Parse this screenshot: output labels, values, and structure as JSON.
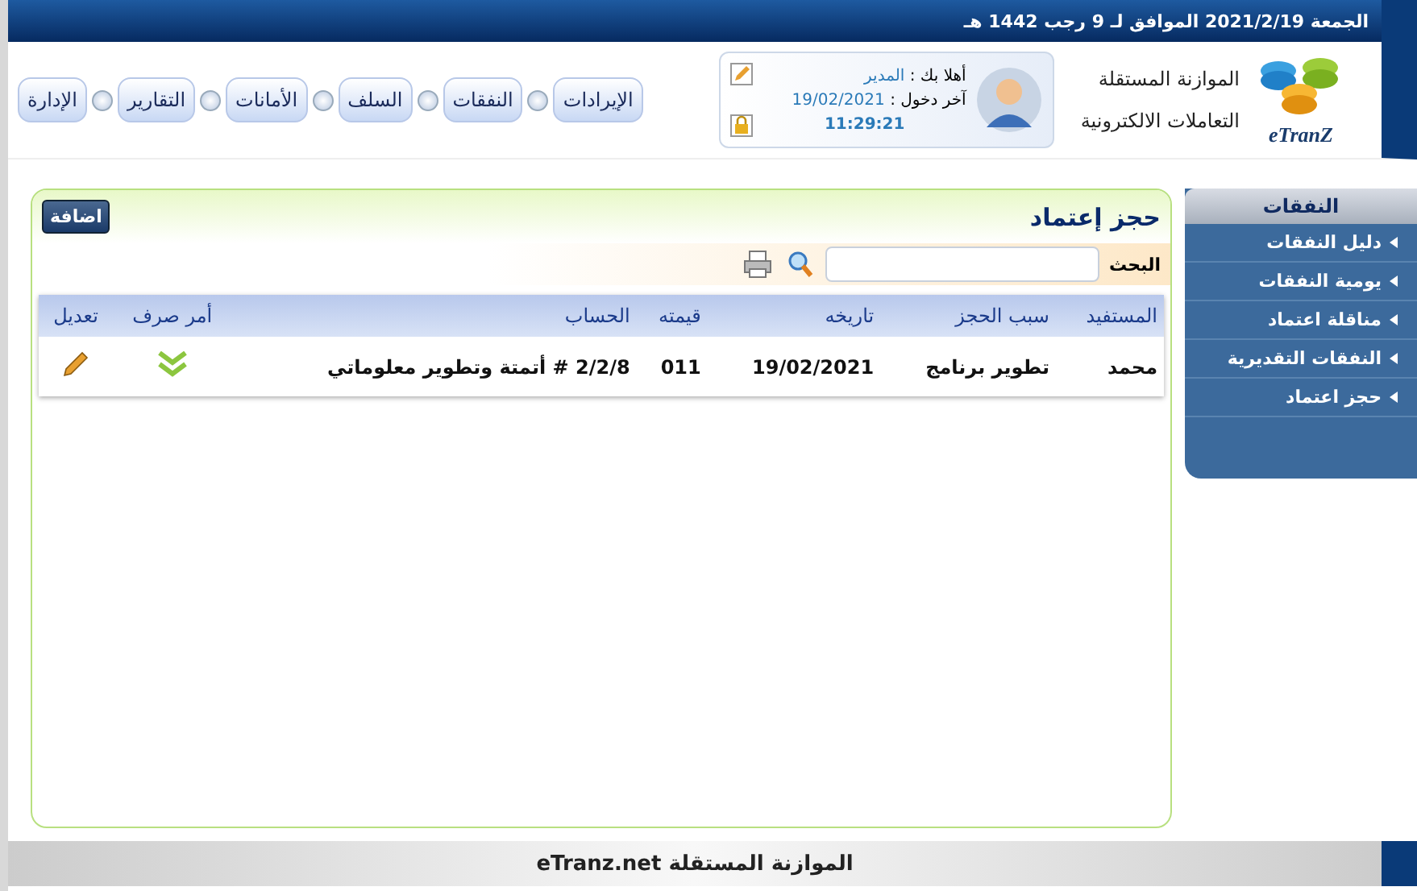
{
  "top_bar": {
    "date": "الجمعة 2021/2/19 الموافق لـ 9 رجب 1442 هـ"
  },
  "logo": {
    "name": "eTranZ",
    "title_line_1": "الموازنة المستقلة",
    "title_line_2": "التعاملات الالكترونية"
  },
  "user_panel": {
    "greeting": "أهلا بك :",
    "user": "المدير",
    "last_login_label": "آخر دخول :",
    "last_login_date": "19/02/2021",
    "last_login_time": "11:29:21"
  },
  "nav": [
    "الإيرادات",
    "النفقات",
    "السلف",
    "الأمانات",
    "التقارير",
    "الإدارة"
  ],
  "sidebar": {
    "title": "النفقات",
    "items": [
      "دليل النفقات",
      "يومية النفقات",
      "مناقلة اعتماد",
      "النفقات التقديرية",
      "حجز اعتماد"
    ]
  },
  "panel": {
    "title": "حجز إعتماد",
    "add_button": "اضافة",
    "search_label": "البحث",
    "table": {
      "columns": [
        "المستفيد",
        "سبب الحجز",
        "تاريخه",
        "قيمته",
        "الحساب",
        "أمر صرف",
        "تعديل"
      ],
      "rows": [
        {
          "cells": [
            "محمد",
            "تطوير برنامج",
            "19/02/2021",
            "011",
            "2/2/8 # أتمتة وتطوير معلوماتي"
          ]
        }
      ]
    }
  },
  "footer": "الموازنة المستقلة eTranz.net"
}
